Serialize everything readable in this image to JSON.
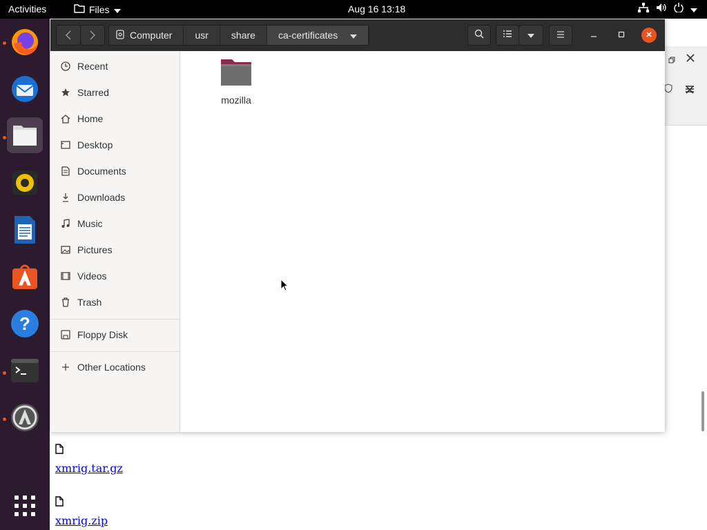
{
  "topbar": {
    "activities": "Activities",
    "app_menu": "Files",
    "clock": "Aug 16  13:18"
  },
  "dock": {
    "items": [
      "firefox-icon",
      "thunderbird-icon",
      "files-icon",
      "rhythmbox-icon",
      "libreoffice-writer-icon",
      "software-icon",
      "help-icon",
      "terminal-icon",
      "software-updater-icon",
      "show-apps-icon"
    ]
  },
  "files": {
    "path": [
      "Computer",
      "usr",
      "share",
      "ca-certificates"
    ],
    "sidebar": [
      {
        "label": "Recent",
        "icon": "clock-icon"
      },
      {
        "label": "Starred",
        "icon": "star-icon"
      },
      {
        "label": "Home",
        "icon": "home-icon"
      },
      {
        "label": "Desktop",
        "icon": "desktop-icon"
      },
      {
        "label": "Documents",
        "icon": "document-icon"
      },
      {
        "label": "Downloads",
        "icon": "download-icon"
      },
      {
        "label": "Music",
        "icon": "music-icon"
      },
      {
        "label": "Pictures",
        "icon": "picture-icon"
      },
      {
        "label": "Videos",
        "icon": "video-icon"
      },
      {
        "label": "Trash",
        "icon": "trash-icon"
      }
    ],
    "devices": [
      {
        "label": "Floppy Disk",
        "icon": "floppy-icon"
      }
    ],
    "other": {
      "label": "Other Locations",
      "icon": "plus-icon"
    },
    "items": [
      {
        "name": "mozilla",
        "type": "folder"
      }
    ]
  },
  "browser": {
    "downloads": [
      {
        "name": "xmrig.tar.gz"
      },
      {
        "name": "xmrig.zip"
      }
    ]
  },
  "colors": {
    "accent": "#e95420",
    "dock_bg": "#2c1a2e",
    "headerbar_bg": "#2d2d2d"
  }
}
